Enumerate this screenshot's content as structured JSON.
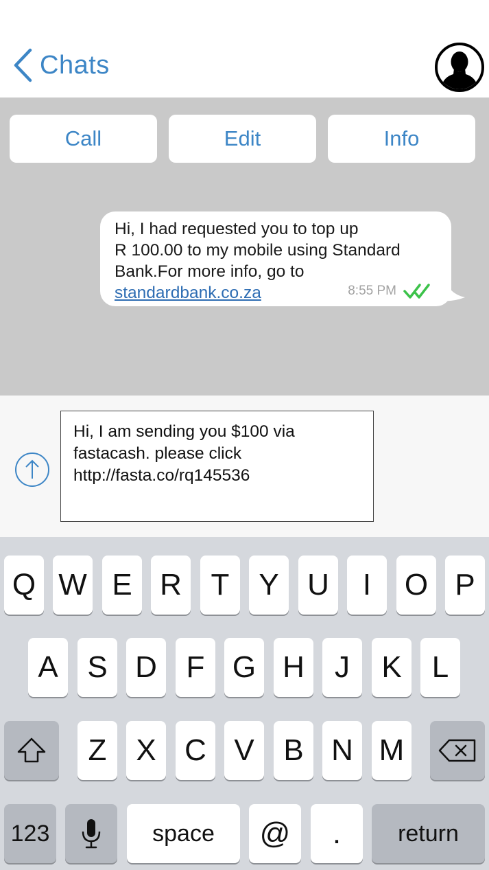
{
  "header": {
    "back_label": "Chats"
  },
  "actions": {
    "call": "Call",
    "edit": "Edit",
    "info": "Info"
  },
  "message": {
    "text": "Hi, I had requested you to top up\nR 100.00 to my mobile using Standard\nBank.For more info, go to",
    "link": "standardbank.co.za",
    "time": "8:55 PM"
  },
  "compose": {
    "text": "Hi, I am sending you $100 via\nfastacash. please click\nhttp://fasta.co/rq145536"
  },
  "keyboard": {
    "row1": [
      "Q",
      "W",
      "E",
      "R",
      "T",
      "Y",
      "U",
      "I",
      "O",
      "P"
    ],
    "row2": [
      "A",
      "S",
      "D",
      "F",
      "G",
      "H",
      "J",
      "K",
      "L"
    ],
    "row3": [
      "Z",
      "X",
      "C",
      "V",
      "B",
      "N",
      "M"
    ],
    "numbers": "123",
    "space": "space",
    "at": "@",
    "period": ".",
    "return": "return"
  },
  "colors": {
    "accent": "#3d86c6",
    "chat_bg": "#c9c9c9",
    "read_tick": "#3cc24a",
    "keyboard_bg": "#d5d8dd"
  }
}
